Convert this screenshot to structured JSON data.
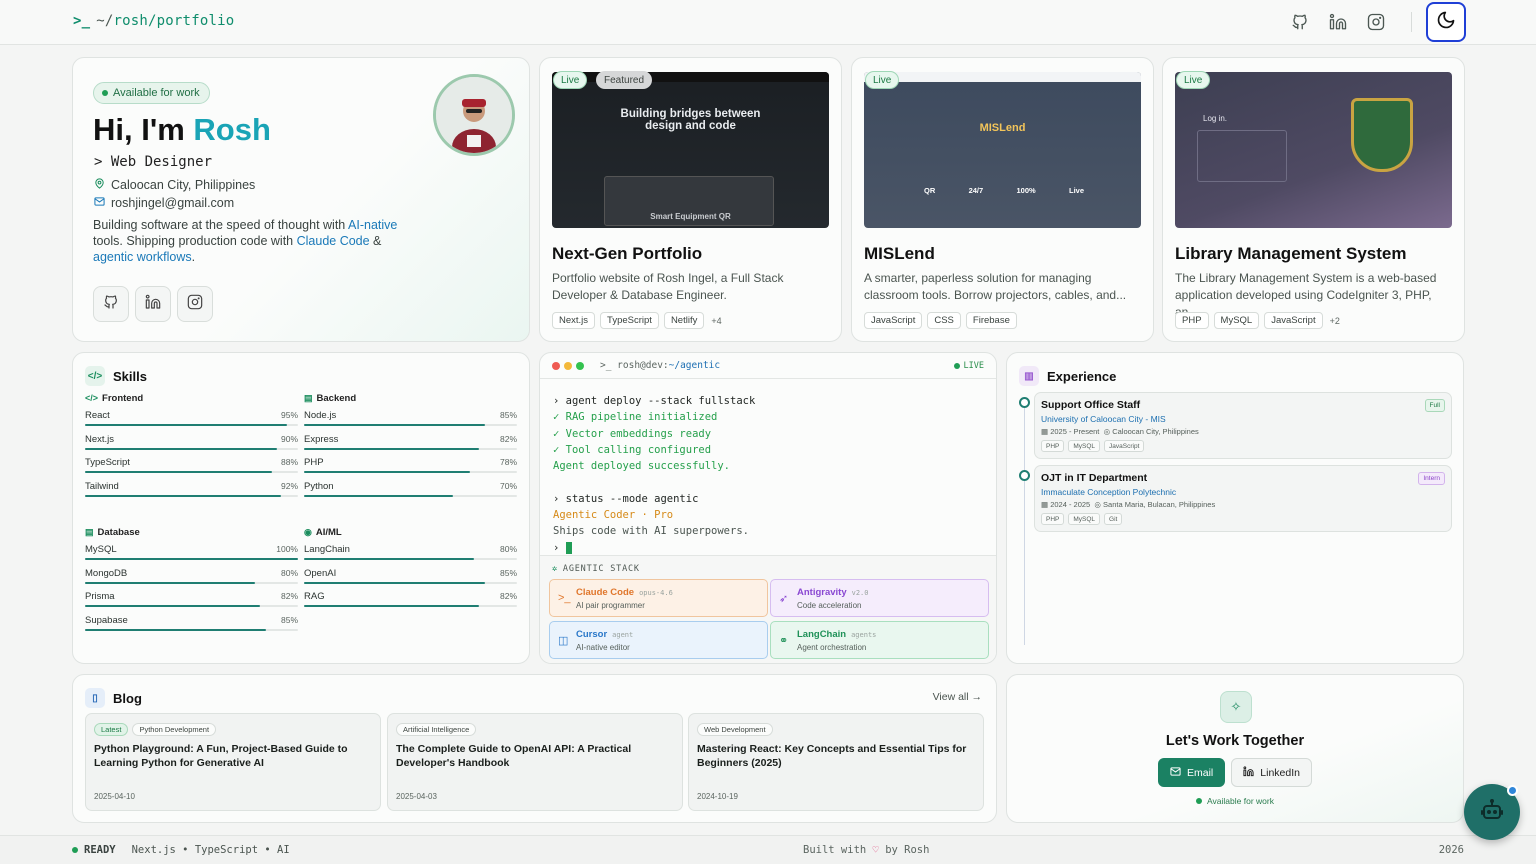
{
  "header": {
    "brand_prompt": ">_",
    "brand_prefix": "~/",
    "brand_path": "rosh/portfolio",
    "icons": [
      "github-icon",
      "linkedin-icon",
      "instagram-icon"
    ],
    "theme_toggle_icon": "moon-icon"
  },
  "hero": {
    "availability": "Available for work",
    "greeting": "Hi, I'm ",
    "name": "Rosh",
    "role": "> Web Designer",
    "location": "Caloocan City, Philippines",
    "email": "roshjingel@gmail.com",
    "bio_1": "Building software at the speed of thought with ",
    "bio_link_1": "AI-native",
    "bio_2": " tools. Shipping production code with ",
    "bio_link_2": "Claude Code",
    "bio_3": " & ",
    "bio_link_3": "agentic workflows",
    "bio_4": "."
  },
  "projects": [
    {
      "title": "Next-Gen Portfolio",
      "live": "Live",
      "featured": "Featured",
      "description": "Portfolio website of Rosh Ingel, a Full Stack Developer & Database Engineer.",
      "tags": [
        "Next.js",
        "TypeScript",
        "Netlify"
      ],
      "more": "+4",
      "shot_heading": "Building bridges between design and code",
      "shot_footer": "Smart Equipment QR"
    },
    {
      "title": "MISLend",
      "live": "Live",
      "description": "A smarter, paperless solution for managing classroom tools. Borrow projectors, cables, and...",
      "tags": [
        "JavaScript",
        "CSS",
        "Firebase"
      ],
      "more": "",
      "shot_heading": "MISLend",
      "shot_stats": [
        "QR",
        "24/7",
        "100%",
        "Live"
      ]
    },
    {
      "title": "Library Management System",
      "live": "Live",
      "description": "The Library Management System is a web-based application developed using CodeIgniter 3, PHP, an...",
      "tags": [
        "PHP",
        "MySQL",
        "JavaScript"
      ],
      "more": "+2",
      "shot_heading": "Log in."
    }
  ],
  "skills": {
    "title": "Skills",
    "groups": [
      {
        "name": "Frontend",
        "items": [
          {
            "name": "React",
            "pct": "95%",
            "value": 95
          },
          {
            "name": "Next.js",
            "pct": "90%",
            "value": 90
          },
          {
            "name": "TypeScript",
            "pct": "88%",
            "value": 88
          },
          {
            "name": "Tailwind",
            "pct": "92%",
            "value": 92
          }
        ]
      },
      {
        "name": "Backend",
        "items": [
          {
            "name": "Node.js",
            "pct": "85%",
            "value": 85
          },
          {
            "name": "Express",
            "pct": "82%",
            "value": 82
          },
          {
            "name": "PHP",
            "pct": "78%",
            "value": 78
          },
          {
            "name": "Python",
            "pct": "70%",
            "value": 70
          }
        ]
      },
      {
        "name": "Database",
        "items": [
          {
            "name": "MySQL",
            "pct": "100%",
            "value": 100
          },
          {
            "name": "MongoDB",
            "pct": "80%",
            "value": 80
          },
          {
            "name": "Prisma",
            "pct": "82%",
            "value": 82
          },
          {
            "name": "Supabase",
            "pct": "85%",
            "value": 85
          }
        ]
      },
      {
        "name": "AI/ML",
        "items": [
          {
            "name": "LangChain",
            "pct": "80%",
            "value": 80
          },
          {
            "name": "OpenAI",
            "pct": "85%",
            "value": 85
          },
          {
            "name": "RAG",
            "pct": "82%",
            "value": 82
          }
        ]
      }
    ]
  },
  "terminal": {
    "title_prefix": ">_ rosh@dev:",
    "title_path": "~/agentic",
    "live": "LIVE",
    "lines": [
      {
        "text": "› agent deploy --stack fullstack",
        "style": "cmd"
      },
      {
        "text": "✓ RAG pipeline initialized",
        "style": "ok"
      },
      {
        "text": "✓ Vector embeddings ready",
        "style": "ok"
      },
      {
        "text": "✓ Tool calling configured",
        "style": "ok"
      },
      {
        "text": "Agent deployed successfully.",
        "style": "ok"
      },
      {
        "text": " ",
        "style": "cmd"
      },
      {
        "text": "› status --mode agentic",
        "style": "cmd"
      },
      {
        "text": "Agentic Coder · Pro",
        "style": "warn"
      },
      {
        "text": "Ships code with AI superpowers.",
        "style": "mut"
      }
    ],
    "prompt": "› ",
    "stack_label": "AGENTIC STACK",
    "stack": [
      {
        "name": "Claude Code",
        "version": "opus-4.6",
        "desc": "AI pair programmer",
        "icon": "terminal-icon",
        "color": "#e0762b"
      },
      {
        "name": "Antigravity",
        "version": "v2.0",
        "desc": "Code acceleration",
        "icon": "rocket-icon",
        "color": "#8a48d2"
      },
      {
        "name": "Cursor",
        "version": "agent",
        "desc": "AI-native editor",
        "icon": "cursor-icon",
        "color": "#2a78c9"
      },
      {
        "name": "LangChain",
        "version": "agents",
        "desc": "Agent orchestration",
        "icon": "link-icon",
        "color": "#1f9158"
      }
    ]
  },
  "experience": {
    "title": "Experience",
    "items": [
      {
        "role": "Support Office Staff",
        "org": "University of Caloocan City - MIS",
        "period": "2025 - Present",
        "location": "Caloocan City, Philippines",
        "tags": [
          "PHP",
          "MySQL",
          "JavaScript"
        ],
        "label": "Full"
      },
      {
        "role": "OJT in IT Department",
        "org": "Immaculate Conception Polytechnic",
        "period": "2024 - 2025",
        "location": "Santa Maria, Bulacan, Philippines",
        "tags": [
          "PHP",
          "MySQL",
          "Git"
        ],
        "label": "Intern"
      }
    ]
  },
  "blog": {
    "title": "Blog",
    "view_all": "View all →",
    "posts": [
      {
        "tags": [
          "Latest",
          "Python Development"
        ],
        "title": "Python Playground: A Fun, Project-Based Guide to Learning Python for Generative AI",
        "date": "2025-04-10"
      },
      {
        "tags": [
          "Artificial Intelligence"
        ],
        "title": "The Complete Guide to OpenAI API: A Practical Developer's Handbook",
        "date": "2025-04-03"
      },
      {
        "tags": [
          "Web Development"
        ],
        "title": "Mastering React: Key Concepts and Essential Tips for Beginners (2025)",
        "date": "2024-10-19"
      }
    ]
  },
  "cta": {
    "title": "Let's Work Together",
    "email_label": "Email",
    "linkedin_label": "LinkedIn",
    "availability": "Available for work"
  },
  "footer": {
    "status": "READY",
    "stack": "Next.js • TypeScript • AI",
    "built_prefix": "Built with ",
    "built_suffix": " by Rosh",
    "year": "2026"
  },
  "colors": {
    "accent": "#0f8d6c",
    "name_accent": "#1aa4b6",
    "bar_fill": "#1f7e72",
    "link": "#1a79b8"
  }
}
